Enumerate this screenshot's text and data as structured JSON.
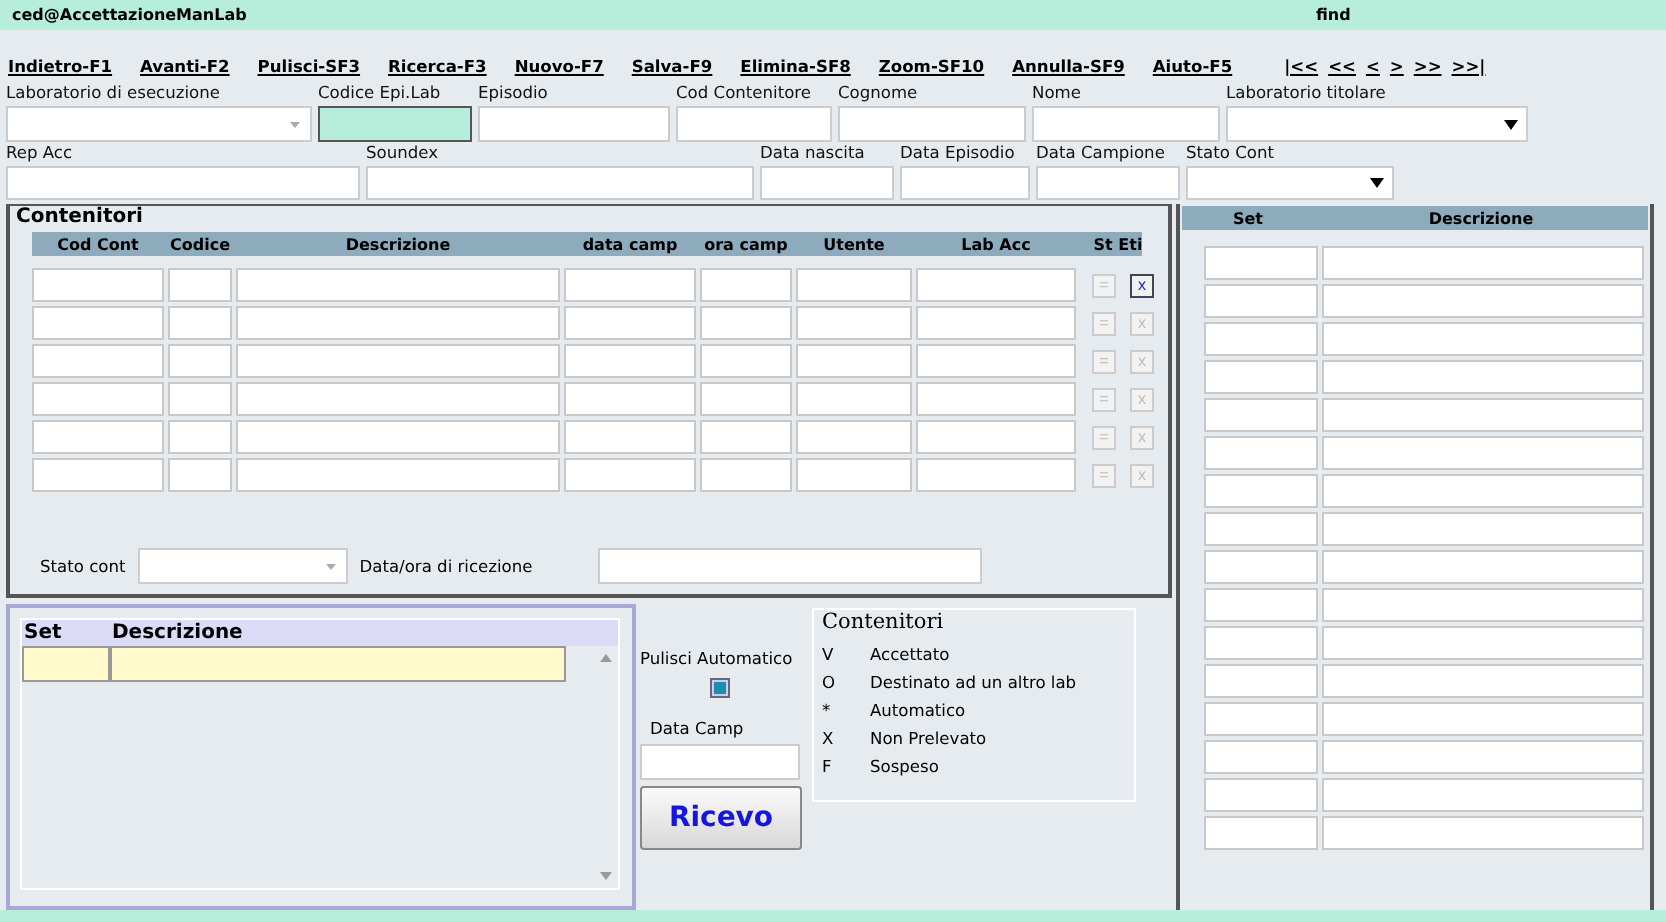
{
  "header": {
    "user": "ced@AccettazioneManLab",
    "mode": "find"
  },
  "toolbar": [
    "Indietro-F1",
    "Avanti-F2",
    "Pulisci-SF3",
    "Ricerca-F3",
    "Nuovo-F7",
    "Salva-F9",
    "Elimina-SF8",
    "Zoom-SF10",
    "Annulla-SF9",
    "Aiuto-F5"
  ],
  "nav": [
    "|<<",
    "<<",
    "<",
    ">",
    ">>",
    ">>|"
  ],
  "filters_row1": [
    {
      "label": "Laboratorio di esecuzione",
      "kind": "select",
      "highlighted": false
    },
    {
      "label": "Codice Epi.Lab",
      "kind": "text",
      "highlighted": true
    },
    {
      "label": "Episodio",
      "kind": "text",
      "highlighted": false
    },
    {
      "label": "Cod Contenitore",
      "kind": "text",
      "highlighted": false
    },
    {
      "label": "Cognome",
      "kind": "text",
      "highlighted": false
    },
    {
      "label": "Nome",
      "kind": "text",
      "highlighted": false
    },
    {
      "label": "Laboratorio titolare",
      "kind": "select",
      "highlighted": false
    }
  ],
  "filters_row2": [
    {
      "label": "Rep Acc",
      "kind": "text",
      "highlighted": false
    },
    {
      "label": "Soundex",
      "kind": "text",
      "highlighted": false
    },
    {
      "label": "Data nascita",
      "kind": "text",
      "highlighted": false
    },
    {
      "label": "Data Episodio",
      "kind": "text",
      "highlighted": false
    },
    {
      "label": "Data Campione",
      "kind": "text",
      "highlighted": false
    },
    {
      "label": "Stato Cont",
      "kind": "select",
      "highlighted": false
    }
  ],
  "containers": {
    "title": "Contenitori",
    "columns": [
      "Cod Cont",
      "Codice",
      "Descrizione",
      "data camp",
      "ora camp",
      "Utente",
      "Lab Acc",
      "St Eti"
    ],
    "rows": [
      {
        "label_mark": "=",
        "delete_mark": "x",
        "delete_enabled": true
      },
      {
        "label_mark": "=",
        "delete_mark": "x",
        "delete_enabled": false
      },
      {
        "label_mark": "=",
        "delete_mark": "x",
        "delete_enabled": false
      },
      {
        "label_mark": "=",
        "delete_mark": "x",
        "delete_enabled": false
      },
      {
        "label_mark": "=",
        "delete_mark": "x",
        "delete_enabled": false
      },
      {
        "label_mark": "=",
        "delete_mark": "x",
        "delete_enabled": false
      }
    ],
    "status_label": "Stato cont",
    "reception_label": "Data/ora di ricezione"
  },
  "sets": {
    "columns": [
      "Set",
      "Descrizione"
    ]
  },
  "auto_clear": {
    "label": "Pulisci Automatico",
    "checked": true
  },
  "date_label": "Data Camp",
  "receive_button": "Ricevo",
  "legend": {
    "title": "Contenitori",
    "items": [
      {
        "code": "V",
        "text": "Accettato"
      },
      {
        "code": "O",
        "text": "Destinato ad un altro lab"
      },
      {
        "code": "*",
        "text": "Automatico"
      },
      {
        "code": "X",
        "text": "Non Prelevato"
      },
      {
        "code": "F",
        "text": "Sospeso"
      }
    ]
  },
  "right_table": {
    "columns": [
      "Set",
      "Descrizione"
    ]
  }
}
